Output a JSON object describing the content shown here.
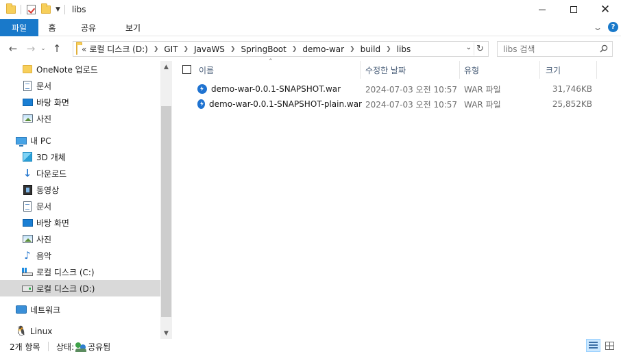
{
  "window": {
    "title": "libs",
    "controls": {
      "minimize": "minimize",
      "maximize": "maximize",
      "close": "✕"
    }
  },
  "ribbon": {
    "tabs": [
      {
        "label": "파일",
        "active": true
      },
      {
        "label": "홈"
      },
      {
        "label": "공유"
      },
      {
        "label": "보기"
      }
    ],
    "accent": "#1979ca",
    "help": "?"
  },
  "address": {
    "overflow": "«",
    "crumbs": [
      "로컬 디스크 (D:)",
      "GIT",
      "JavaWS",
      "SpringBoot",
      "demo-war",
      "build",
      "libs"
    ]
  },
  "search": {
    "placeholder": "libs 검색"
  },
  "nav": {
    "items": [
      {
        "label": "OneNote 업로드",
        "icon": "folder-icon"
      },
      {
        "label": "문서",
        "icon": "documents-icon"
      },
      {
        "label": "바탕 화면",
        "icon": "desktop-icon"
      },
      {
        "label": "사진",
        "icon": "pictures-icon"
      },
      {
        "label": "내 PC",
        "icon": "this-pc-icon"
      },
      {
        "label": "3D 개체",
        "icon": "3d-objects-icon"
      },
      {
        "label": "다운로드",
        "icon": "downloads-icon"
      },
      {
        "label": "동영상",
        "icon": "videos-icon"
      },
      {
        "label": "문서",
        "icon": "documents-icon"
      },
      {
        "label": "바탕 화면",
        "icon": "desktop-icon"
      },
      {
        "label": "사진",
        "icon": "pictures-icon"
      },
      {
        "label": "음악",
        "icon": "music-icon"
      },
      {
        "label": "로컬 디스크 (C:)",
        "icon": "drive-c-icon"
      },
      {
        "label": "로컬 디스크 (D:)",
        "icon": "drive-icon",
        "selected": true
      },
      {
        "label": "네트워크",
        "icon": "network-icon"
      },
      {
        "label": "Linux",
        "icon": "linux-icon"
      }
    ]
  },
  "columns": {
    "name": "이름",
    "modified": "수정한 날짜",
    "type": "유형",
    "size": "크기"
  },
  "files": [
    {
      "name": "demo-war-0.0.1-SNAPSHOT.war",
      "modified": "2024-07-03 오전 10:57",
      "type": "WAR 파일",
      "size": "31,746KB",
      "icon": "war-file-icon"
    },
    {
      "name": "demo-war-0.0.1-SNAPSHOT-plain.war",
      "modified": "2024-07-03 오전 10:57",
      "type": "WAR 파일",
      "size": "25,852KB",
      "icon": "war-file-icon"
    }
  ],
  "status": {
    "count": "2개 항목",
    "state_label": "상태:",
    "state_value": "공유됨"
  }
}
